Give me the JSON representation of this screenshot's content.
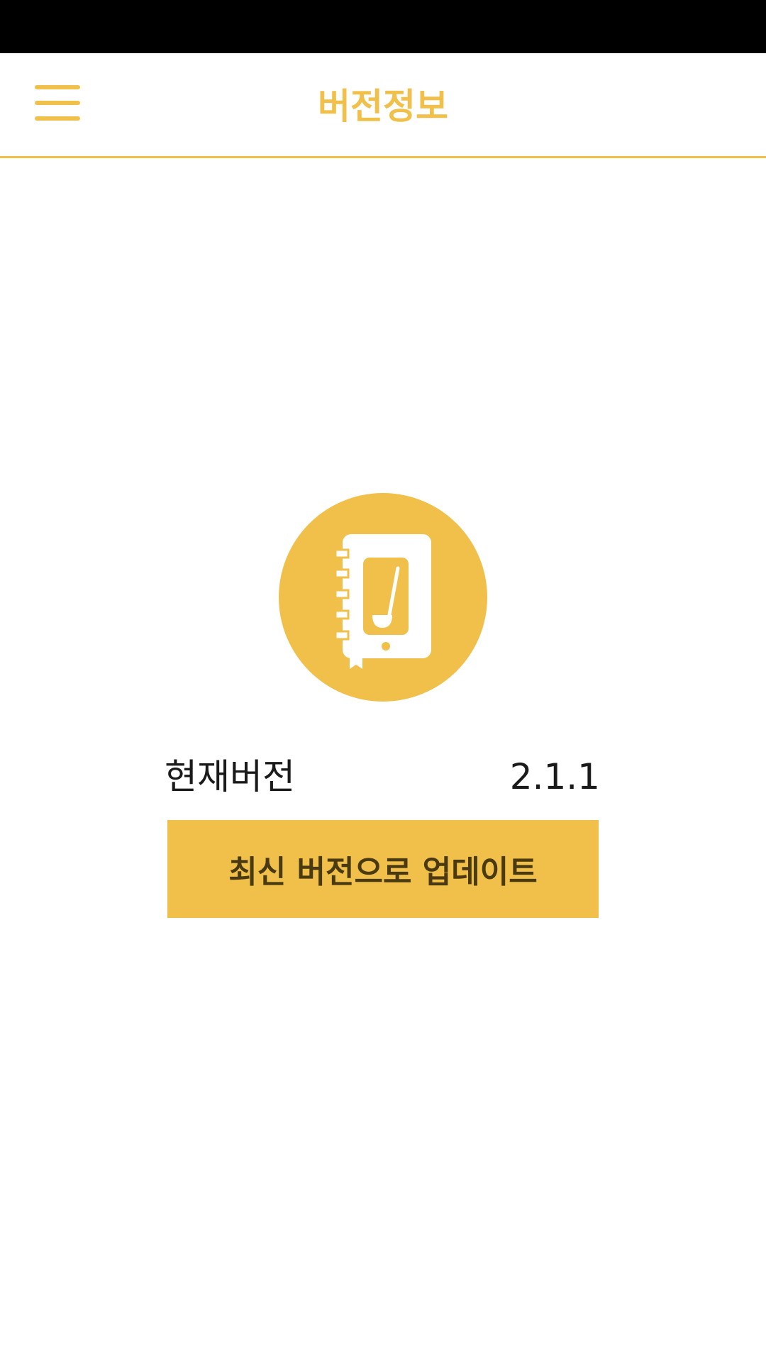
{
  "header": {
    "title": "버전정보",
    "menu_icon": "hamburger-menu-icon"
  },
  "logo": {
    "icon": "recipe-book-ladle-icon"
  },
  "version_info": {
    "label": "현재버전",
    "value": "2.1.1"
  },
  "update_button": {
    "label": "최신 버전으로 업데이트"
  },
  "colors": {
    "accent": "#f0c04a",
    "button_text": "#4a3a12",
    "text": "#1a1a1a",
    "status_bar": "#000000"
  }
}
